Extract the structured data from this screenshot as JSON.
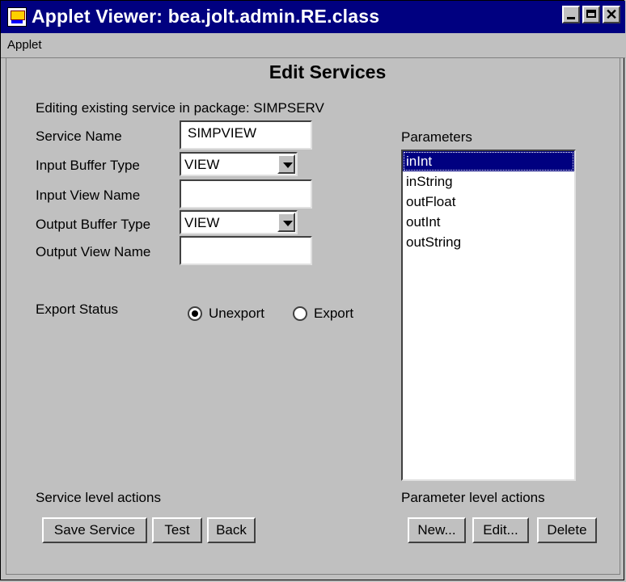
{
  "window": {
    "title": "Applet Viewer: bea.jolt.admin.RE.class"
  },
  "menu": {
    "items": [
      "Applet"
    ]
  },
  "page": {
    "heading": "Edit Services",
    "subtitle": "Editing existing service in package: SIMPSERV"
  },
  "form": {
    "service_name": {
      "label": "Service Name",
      "value": "SIMPVIEW"
    },
    "input_buffer_type": {
      "label": "Input Buffer Type",
      "value": "VIEW"
    },
    "input_view_name": {
      "label": "Input View Name",
      "value": ""
    },
    "output_buffer_type": {
      "label": "Output Buffer Type",
      "value": "VIEW"
    },
    "output_view_name": {
      "label": "Output View Name",
      "value": ""
    },
    "export_status": {
      "label": "Export Status",
      "options": [
        "Unexport",
        "Export"
      ],
      "selected": "Unexport"
    }
  },
  "parameters": {
    "label": "Parameters",
    "items": [
      "inInt",
      "inString",
      "outFloat",
      "outInt",
      "outString"
    ],
    "selected": "inInt"
  },
  "service_actions": {
    "label": "Service level actions",
    "buttons": [
      "Save Service",
      "Test",
      "Back"
    ]
  },
  "parameter_actions": {
    "label": "Parameter level actions",
    "buttons": [
      "New...",
      "Edit...",
      "Delete"
    ]
  }
}
